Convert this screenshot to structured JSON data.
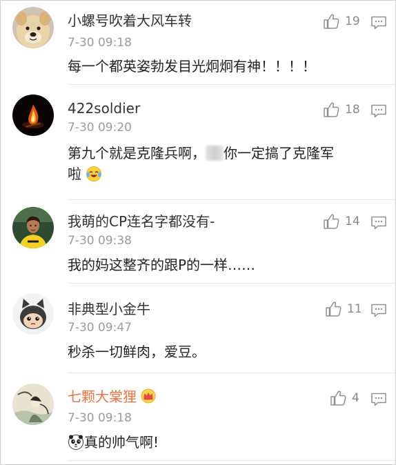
{
  "colors": {
    "username": "#333333",
    "vip_username": "#eb7340",
    "time": "#9b9b9b",
    "like_icon": "#8f8f8f",
    "divider": "#e8e8e8"
  },
  "comments": [
    {
      "username": "小螺号吹着大风车转",
      "time": "7-30 09:18",
      "likes": "19",
      "content": "每一个都英姿勃发目光炯炯有神！！！！",
      "avatar_icon": "dog-avatar-icon"
    },
    {
      "username": "422soldier",
      "time": "7-30 09:20",
      "likes": "18",
      "content_before": "第九个就是克隆兵啊，",
      "content_after": "你一定搞了克隆军",
      "content_line2": "啦",
      "avatar_icon": "campfire-avatar-icon",
      "emoji_icon": "crying-laughing-emoji-icon"
    },
    {
      "username": "我萌的CP连名字都没有-",
      "time": "7-30 09:38",
      "likes": "14",
      "content": "我的妈这整齐的跟P的一样……",
      "avatar_icon": "footballer-avatar-icon"
    },
    {
      "username": "非典型小金牛",
      "time": "7-30 09:47",
      "likes": "11",
      "content": "秒杀一切鲜肉，爱豆。",
      "avatar_icon": "cartoon-cat-avatar-icon"
    },
    {
      "username": "七颗大棠狸",
      "time": "7-30 09:18",
      "likes": "4",
      "content": "真的帅气啊!",
      "avatar_icon": "ink-painting-avatar-icon",
      "badge_icon": "vip-crown-icon",
      "emoji_icon": "panda-emoji-icon"
    }
  ]
}
